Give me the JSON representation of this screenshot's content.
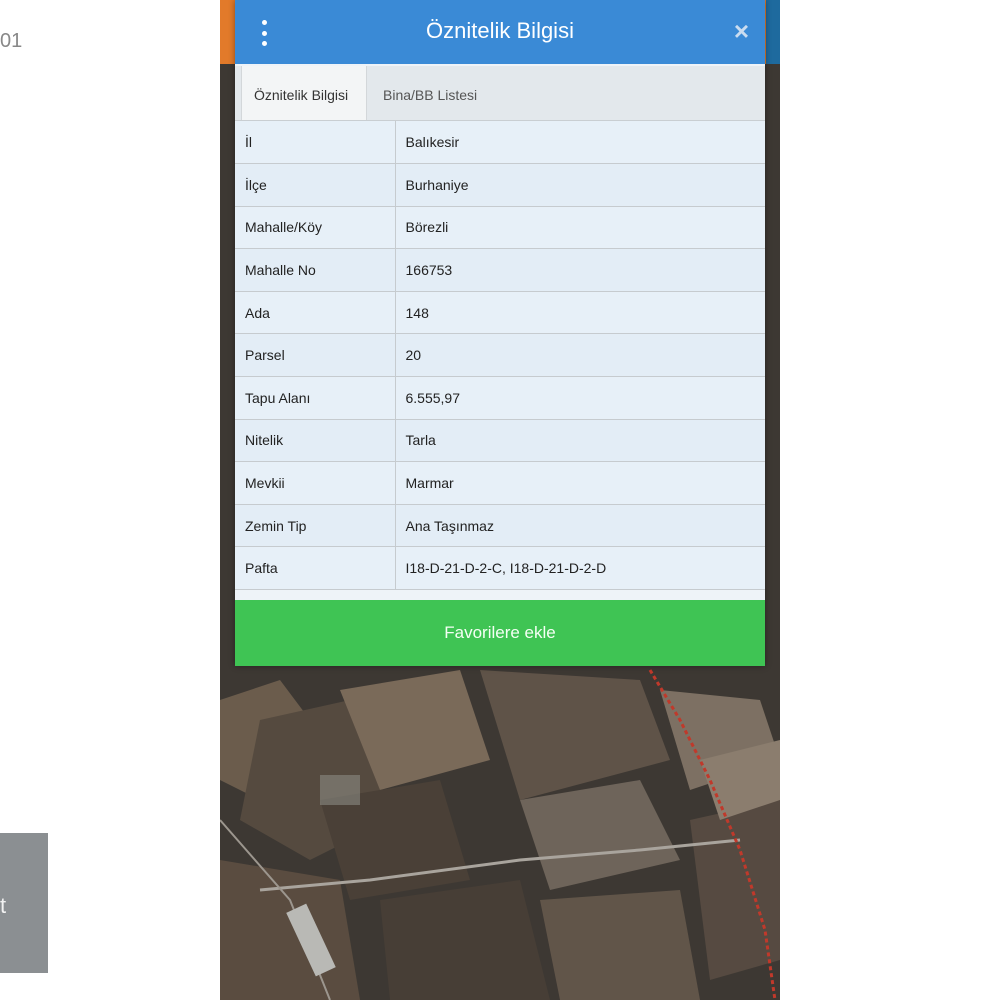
{
  "left_panel": {
    "corner_text": "01",
    "thumb_text": "t"
  },
  "dialog": {
    "title": "Öznitelik Bilgisi",
    "close_label": "×",
    "tabs": [
      {
        "label": "Öznitelik Bilgisi",
        "active": true
      },
      {
        "label": "Bina/BB Listesi",
        "active": false
      }
    ],
    "rows": [
      {
        "key": "İl",
        "value": "Balıkesir"
      },
      {
        "key": "İlçe",
        "value": "Burhaniye"
      },
      {
        "key": "Mahalle/Köy",
        "value": "Börezli"
      },
      {
        "key": "Mahalle No",
        "value": "166753"
      },
      {
        "key": "Ada",
        "value": "148"
      },
      {
        "key": "Parsel",
        "value": "20"
      },
      {
        "key": "Tapu Alanı",
        "value": "6.555,97"
      },
      {
        "key": "Nitelik",
        "value": "Tarla"
      },
      {
        "key": "Mevkii",
        "value": "Marmar"
      },
      {
        "key": "Zemin Tip",
        "value": "Ana Taşınmaz"
      },
      {
        "key": "Pafta",
        "value": "I18-D-21-D-2-C, I18-D-21-D-2-D"
      }
    ],
    "favorite_button": "Favorilere ekle"
  },
  "colors": {
    "header": "#3a8ad6",
    "button": "#3fc454",
    "app_bar": "#e27a2a"
  },
  "icons": {
    "menu": "more-vertical-icon",
    "close": "close-icon"
  }
}
